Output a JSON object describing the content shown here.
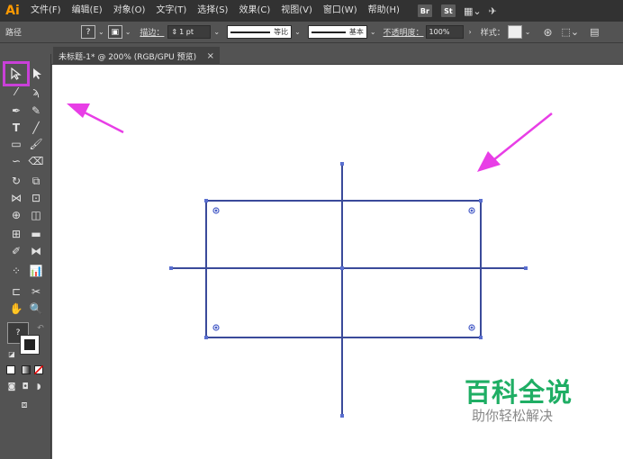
{
  "app": {
    "logo": "Ai",
    "menu": [
      "文件(F)",
      "编辑(E)",
      "对象(O)",
      "文字(T)",
      "选择(S)",
      "效果(C)",
      "视图(V)",
      "窗口(W)",
      "帮助(H)"
    ],
    "bridge_badge": "Br",
    "stock_badge": "St"
  },
  "control_bar": {
    "selection_label": "路径",
    "fill_swatch_text": "?",
    "stroke_label": "描边：",
    "stroke_weight": "1 pt",
    "profile_label": "等比",
    "brush_label": "基本",
    "opacity_label": "不透明度：",
    "opacity_value": "100%",
    "style_label": "样式："
  },
  "document": {
    "tab_title": "未标题-1* @ 200% (RGB/GPU 预览)",
    "close_glyph": "×"
  },
  "tools_panel": {
    "fill_swatch_text": "?"
  },
  "watermark": {
    "title": "百科全说",
    "subtitle": "助你轻松解决"
  },
  "colors": {
    "selection_highlight": "#c940d8",
    "arrow": "#e83ee6",
    "path_stroke": "#3a4a9a",
    "watermark_green": "#1fae64"
  }
}
